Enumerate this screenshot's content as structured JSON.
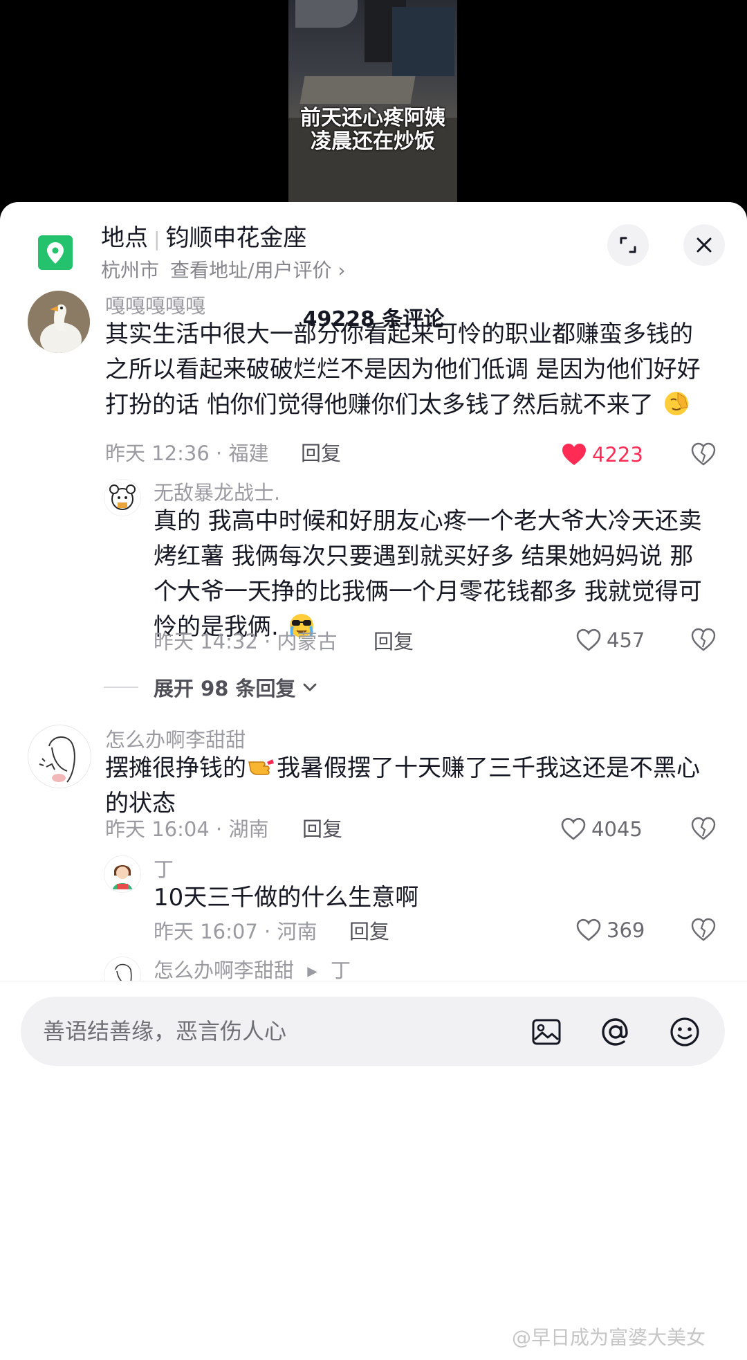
{
  "video": {
    "caption_line1": "前天还心疼阿姨",
    "caption_line2": "凌晨还在炒饭"
  },
  "location": {
    "label": "地点",
    "name": "钧顺申花金座",
    "city": "杭州市",
    "link": "查看地址/用户评价 ›"
  },
  "comments_header": "49228 条评论",
  "comments": [
    {
      "user": "嘎嘎嘎嘎嘎",
      "text": "其实生活中很大一部分你看起来可怜的职业都赚蛮多钱的 之所以看起来破破烂烂不是因为他们低调 是因为他们好好打扮的话 怕你们觉得他赚你们太多钱了然后就不来了",
      "meta": "昨天 12:36 · 福建",
      "reply": "回复",
      "likes": "4223"
    },
    {
      "user": "无敌暴龙战士.",
      "text": "真的 我高中时候和好朋友心疼一个老大爷大冷天还卖烤红薯 我俩每次只要遇到就买好多 结果她妈妈说 那个大爷一天挣的比我俩一个月零花钱都多 我就觉得可怜的是我俩.",
      "meta": "昨天 14:32 · 内蒙古",
      "reply": "回复",
      "likes": "457"
    },
    {
      "user": "怎么办啊李甜甜",
      "text_a": "摆摊很挣钱的",
      "text_b": "我暑假摆了十天赚了三千我这还是不黑心的状态",
      "meta": "昨天 16:04 · 湖南",
      "reply": "回复",
      "likes": "4045"
    },
    {
      "user": "丁",
      "text": "10天三千做的什么生意啊",
      "meta": "昨天 16:07 · 河南",
      "reply": "回复",
      "likes": "369"
    },
    {
      "user": "怎么办啊李甜甜",
      "arrow": "▸",
      "reply_to": "丁"
    }
  ],
  "expand_replies": "展开 98 条回复",
  "input": {
    "placeholder": "善语结善缘，恶言伤人心"
  },
  "watermark": "@早日成为富婆大美女",
  "colors": {
    "accent": "#fe2c55",
    "location_green": "#25c26e"
  }
}
